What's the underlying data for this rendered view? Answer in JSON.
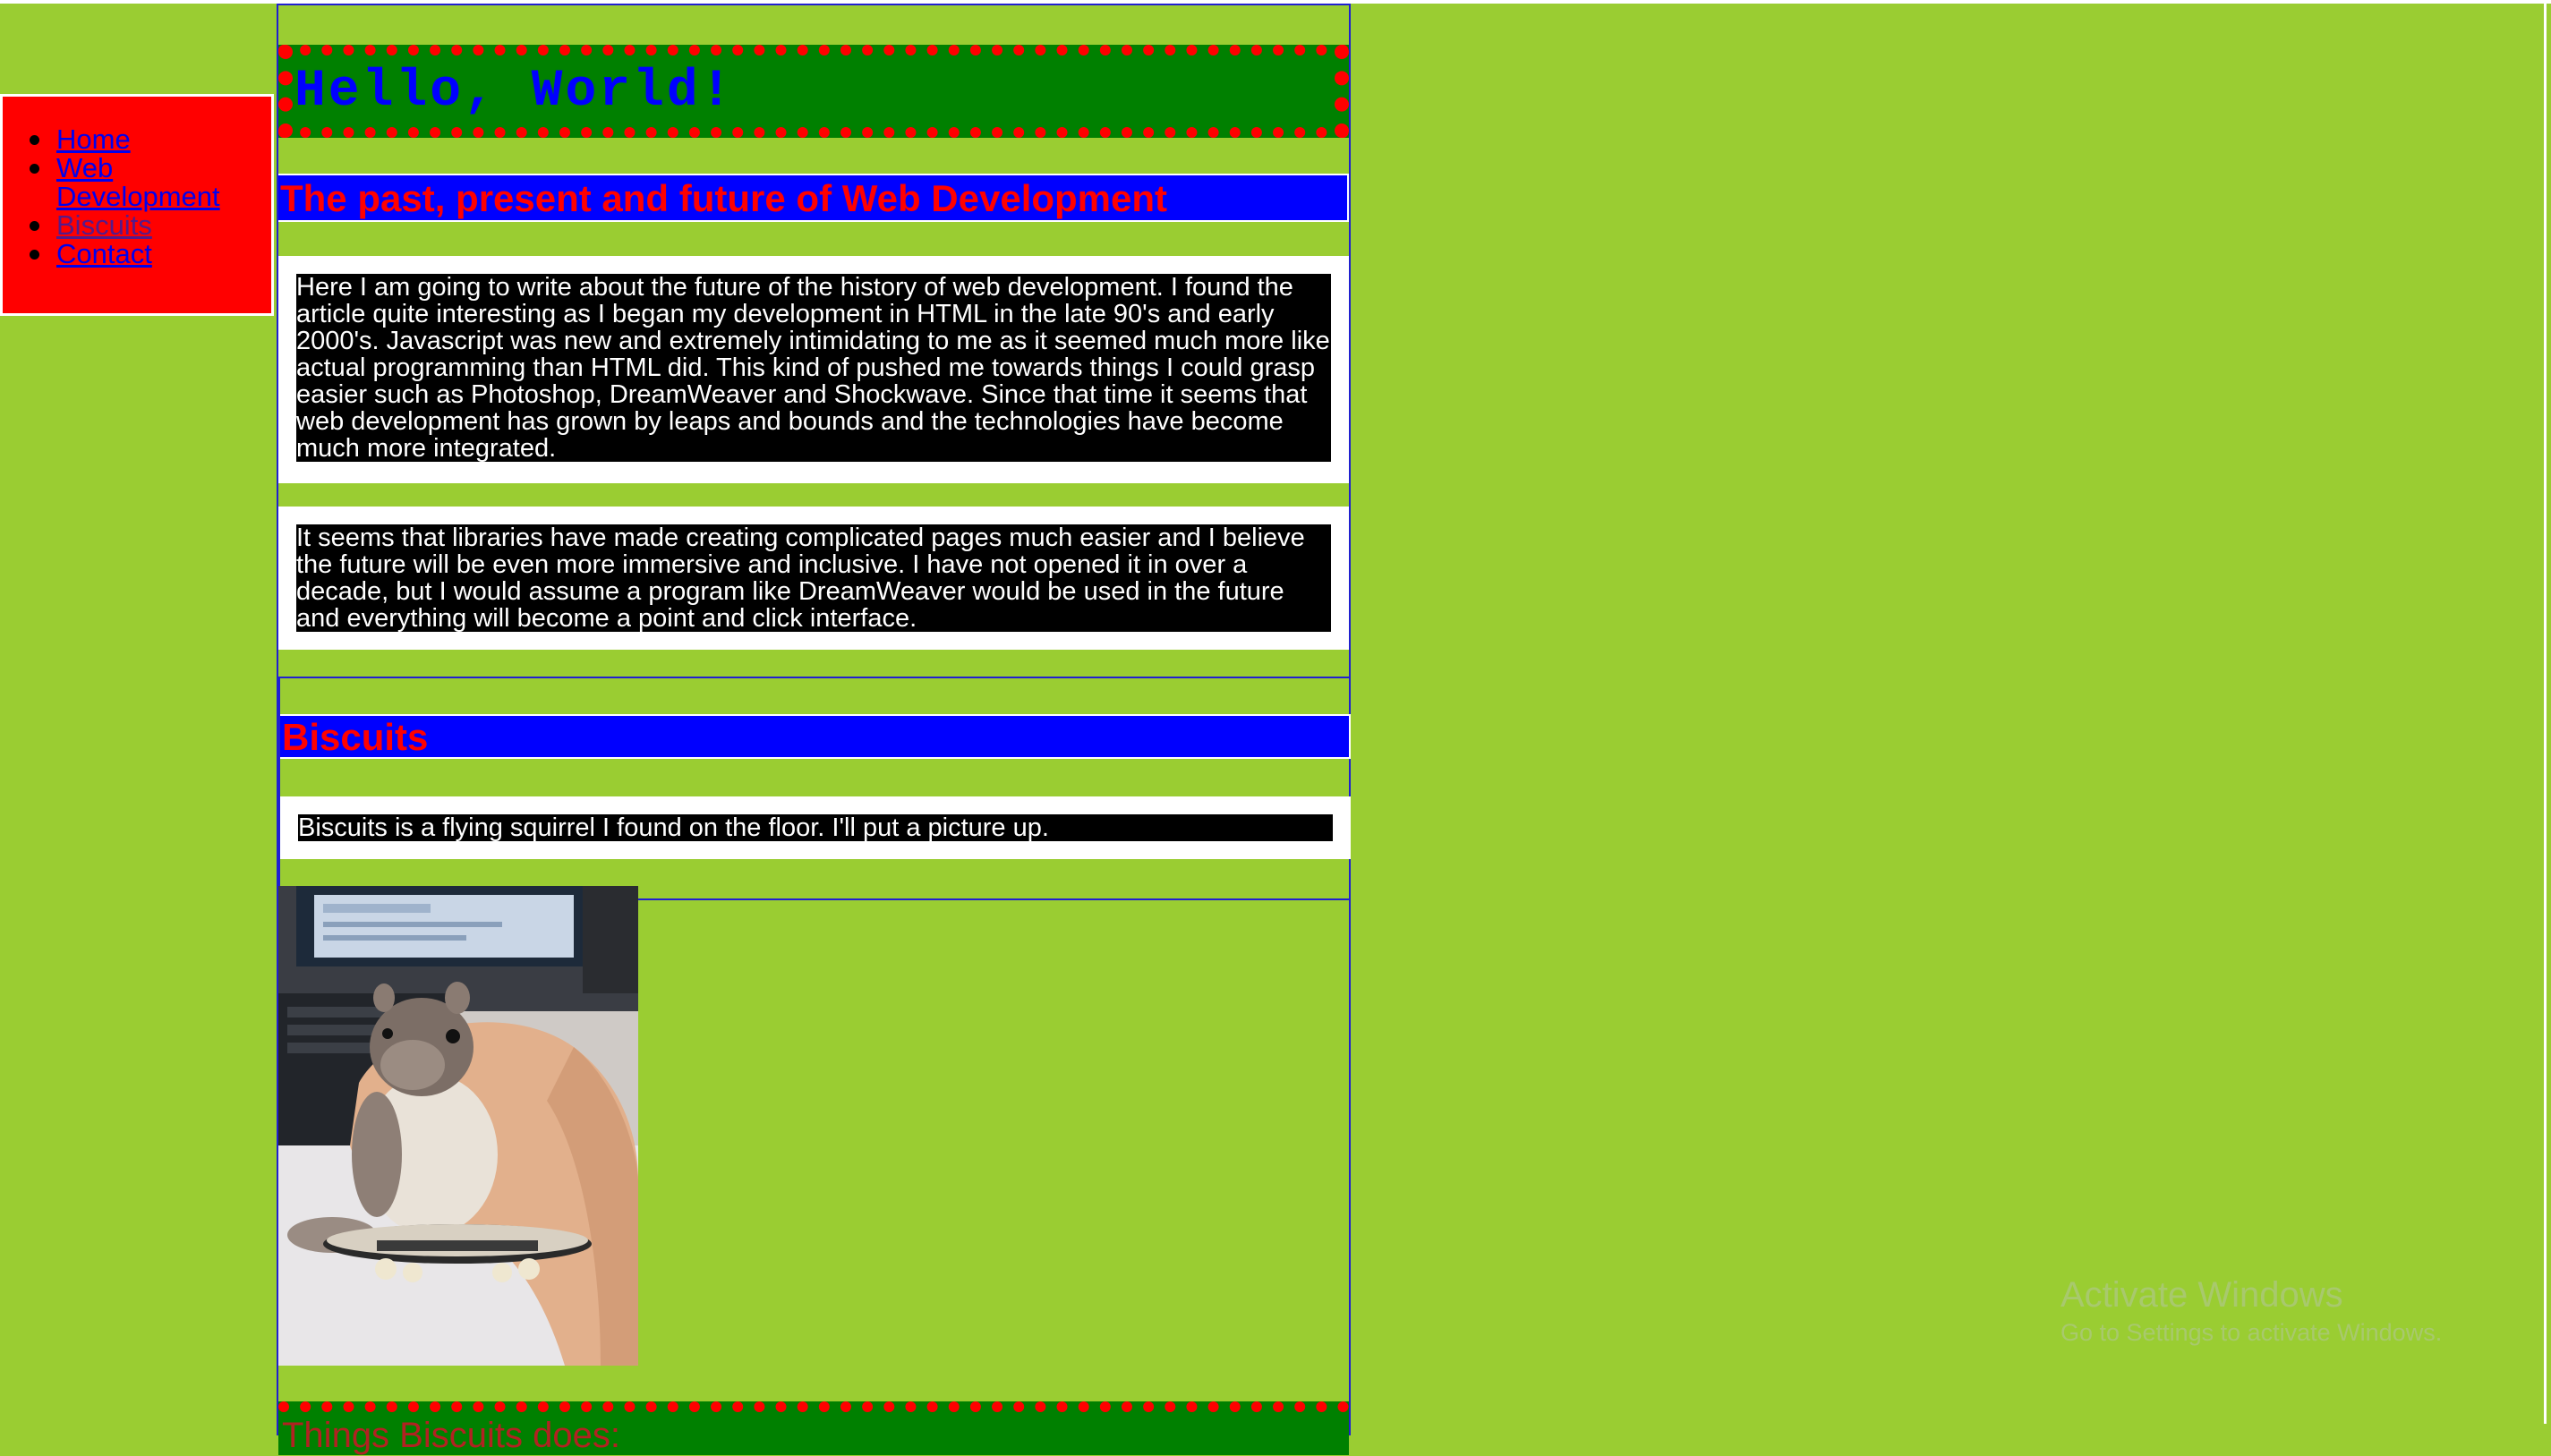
{
  "colors": {
    "page_background": "#9acd32",
    "nav_background": "#ff0000",
    "banner_background": "#008000",
    "banner_border": "#ff0000",
    "banner_title": "#0000ff",
    "heading_background": "#0000ff",
    "heading_text": "#ff0000",
    "paragraph_background": "#000000",
    "paragraph_text": "#ffffff",
    "column_border": "#2020d0"
  },
  "nav": {
    "items": [
      {
        "label": "Home"
      },
      {
        "label": "Web Development"
      },
      {
        "label": "Biscuits"
      },
      {
        "label": "Contact"
      }
    ]
  },
  "banner": {
    "title": "Hello, World!"
  },
  "web_dev": {
    "heading": "The past, present and future of Web Development",
    "paragraph1": "Here I am going to write about the future of the history of web development. I found the article quite interesting as I began my development in HTML in the late 90's and early 2000's. Javascript was new and extremely intimidating to me as it seemed much more like actual programming than HTML did. This kind of pushed me towards things I could grasp easier such as Photoshop, DreamWeaver and Shockwave. Since that time it seems that web development has grown by leaps and bounds and the technologies have become much more integrated.",
    "paragraph2": "It seems that libraries have made creating complicated pages much easier and I believe the future will be even more immersive and inclusive. I have not opened it in over a decade, but I would assume a program like DreamWeaver would be used in the future and everything will become a point and click interface."
  },
  "biscuits": {
    "heading": "Biscuits",
    "paragraph": "Biscuits is a flying squirrel I found on the floor. I'll put a picture up.",
    "photo_icon": "flying-squirrel-on-skateboard-photo"
  },
  "next_section": {
    "heading": "Things Biscuits does:"
  },
  "watermark": {
    "line1": "Activate Windows",
    "line2": "Go to Settings to activate Windows."
  }
}
